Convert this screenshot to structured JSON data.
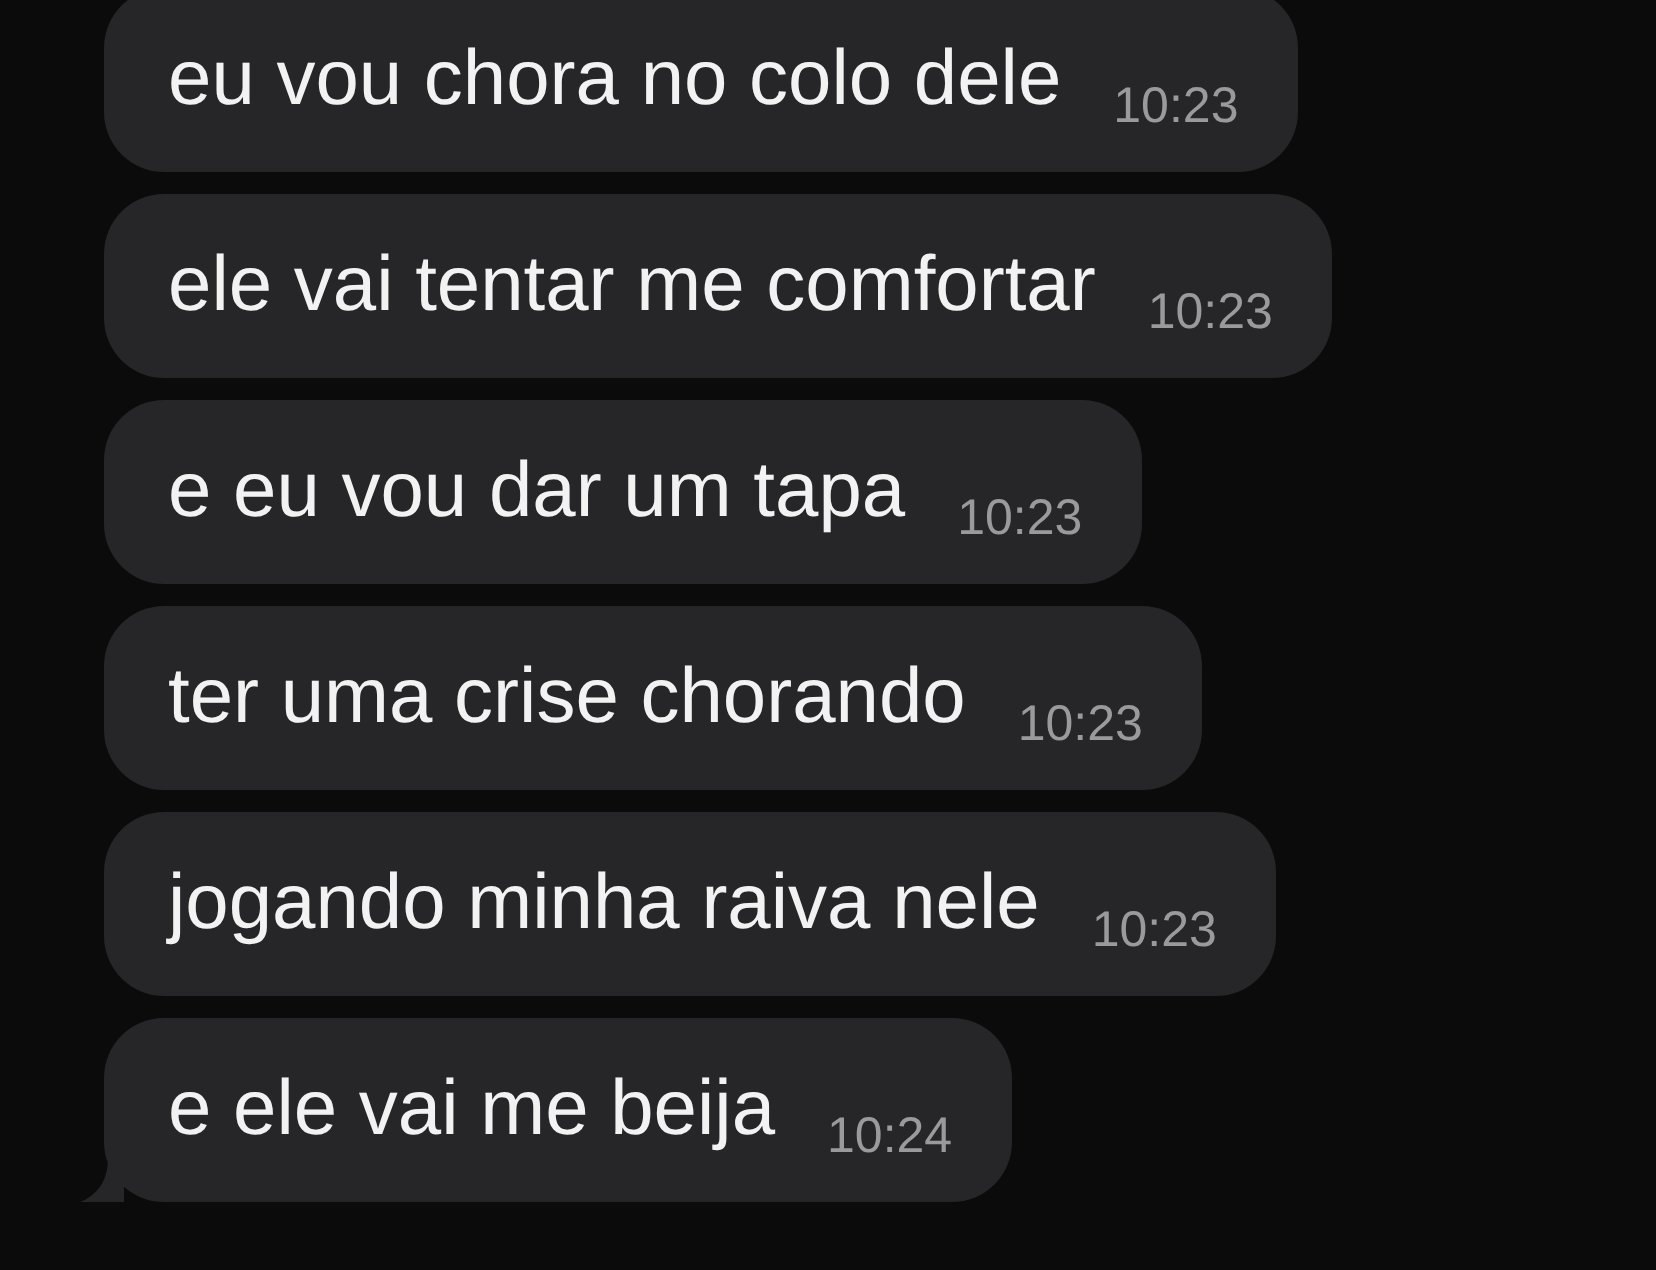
{
  "messages": [
    {
      "text": "eu vou chora no colo dele",
      "time": "10:23",
      "tail": false
    },
    {
      "text": "ele vai tentar me comfortar",
      "time": "10:23",
      "tail": false
    },
    {
      "text": "e eu vou dar um tapa",
      "time": "10:23",
      "tail": false
    },
    {
      "text": "ter uma crise chorando",
      "time": "10:23",
      "tail": false
    },
    {
      "text": "jogando minha raiva nele",
      "time": "10:23",
      "tail": false
    },
    {
      "text": "e ele vai me beija",
      "time": "10:24",
      "tail": true
    }
  ]
}
